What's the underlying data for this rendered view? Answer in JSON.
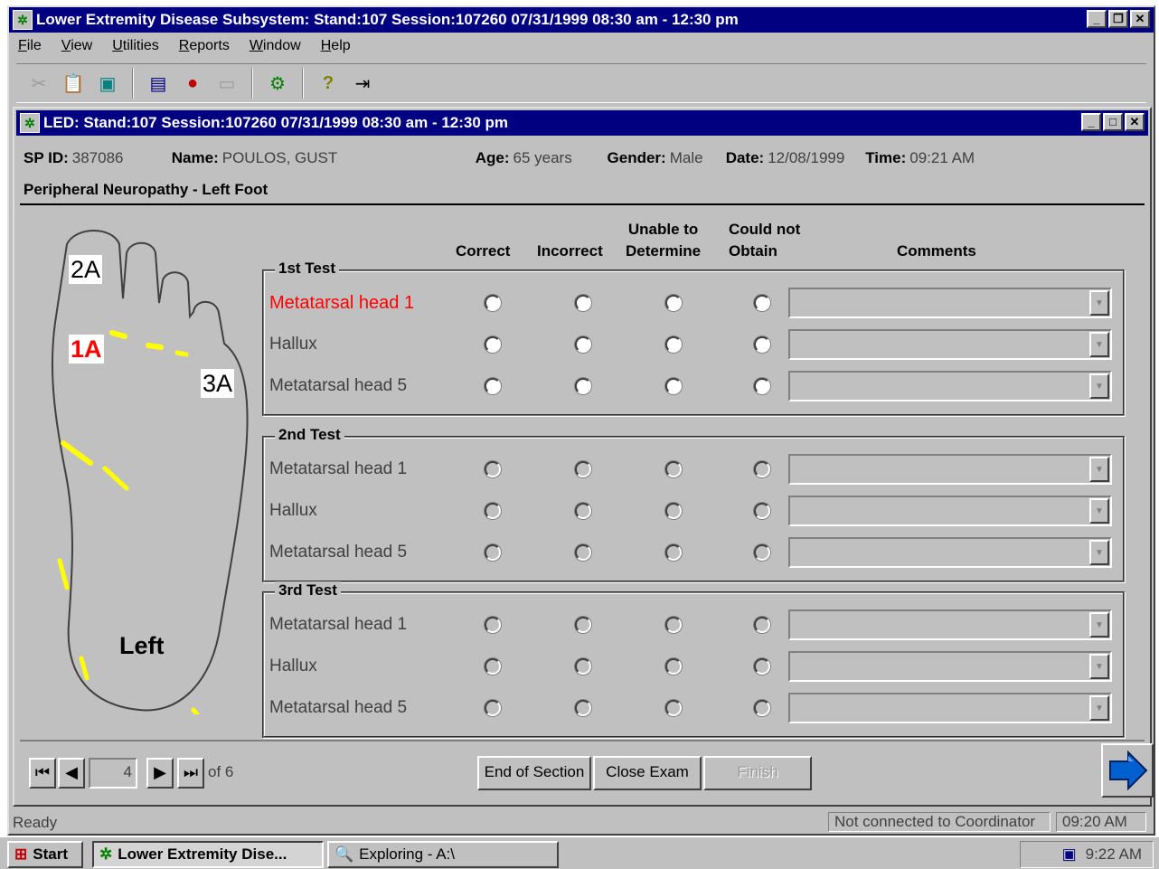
{
  "app": {
    "outer_title": "Lower Extremity Disease Subsystem: Stand:107 Session:107260 07/31/1999 08:30 am - 12:30 pm",
    "menu": [
      "File",
      "View",
      "Utilities",
      "Reports",
      "Window",
      "Help"
    ]
  },
  "window": {
    "title": "LED: Stand:107 Session:107260 07/31/1999 08:30 am - 12:30 pm"
  },
  "patient": {
    "sp_id_label": "SP ID:",
    "sp_id": "387086",
    "name_label": "Name:",
    "name": "POULOS, GUST",
    "age_label": "Age:",
    "age": "65 years",
    "gender_label": "Gender:",
    "gender": "Male",
    "date_label": "Date:",
    "date": "12/08/1999",
    "time_label": "Time:",
    "time": "09:21 AM"
  },
  "section_title": "Peripheral Neuropathy - Left Foot",
  "foot": {
    "label_2a": "2A",
    "label_1a": "1A",
    "label_3a": "3A",
    "side": "Left"
  },
  "columns": {
    "correct": "Correct",
    "incorrect": "Incorrect",
    "unable_1": "Unable to",
    "unable_2": "Determine",
    "could_1": "Could not",
    "could_2": "Obtain",
    "comments": "Comments"
  },
  "tests": [
    {
      "title": "1st Test",
      "rows": [
        "Metatarsal head 1",
        "Hallux",
        "Metatarsal head 5"
      ]
    },
    {
      "title": "2nd Test",
      "rows": [
        "Metatarsal head 1",
        "Hallux",
        "Metatarsal head 5"
      ]
    },
    {
      "title": "3rd Test",
      "rows": [
        "Metatarsal head 1",
        "Hallux",
        "Metatarsal head 5"
      ]
    }
  ],
  "navigation": {
    "page": "4",
    "of_total": "of 6",
    "end_of_section": "End of Section",
    "close_exam": "Close Exam",
    "finish": "Finish"
  },
  "status": {
    "ready": "Ready",
    "connection": "Not connected to Coordinator",
    "time": "09:20 AM"
  },
  "taskbar": {
    "start": "Start",
    "task1": "Lower Extremity Dise...",
    "task2": "Exploring - A:\\",
    "clock": "9:22 AM"
  },
  "colors": {
    "titlebar": "#000080",
    "active_row": "#ff0000",
    "face": "#c0c0c0",
    "highlight": "#ffff00"
  }
}
